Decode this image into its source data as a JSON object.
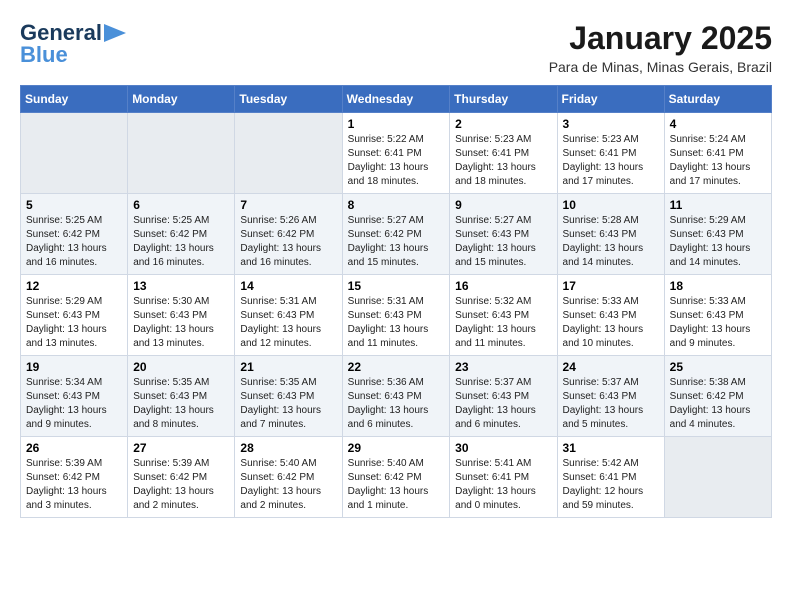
{
  "logo": {
    "line1": "General",
    "line2": "Blue"
  },
  "title": "January 2025",
  "location": "Para de Minas, Minas Gerais, Brazil",
  "days_header": [
    "Sunday",
    "Monday",
    "Tuesday",
    "Wednesday",
    "Thursday",
    "Friday",
    "Saturday"
  ],
  "weeks": [
    [
      {
        "day": "",
        "info": ""
      },
      {
        "day": "",
        "info": ""
      },
      {
        "day": "",
        "info": ""
      },
      {
        "day": "1",
        "info": "Sunrise: 5:22 AM\nSunset: 6:41 PM\nDaylight: 13 hours\nand 18 minutes."
      },
      {
        "day": "2",
        "info": "Sunrise: 5:23 AM\nSunset: 6:41 PM\nDaylight: 13 hours\nand 18 minutes."
      },
      {
        "day": "3",
        "info": "Sunrise: 5:23 AM\nSunset: 6:41 PM\nDaylight: 13 hours\nand 17 minutes."
      },
      {
        "day": "4",
        "info": "Sunrise: 5:24 AM\nSunset: 6:41 PM\nDaylight: 13 hours\nand 17 minutes."
      }
    ],
    [
      {
        "day": "5",
        "info": "Sunrise: 5:25 AM\nSunset: 6:42 PM\nDaylight: 13 hours\nand 16 minutes."
      },
      {
        "day": "6",
        "info": "Sunrise: 5:25 AM\nSunset: 6:42 PM\nDaylight: 13 hours\nand 16 minutes."
      },
      {
        "day": "7",
        "info": "Sunrise: 5:26 AM\nSunset: 6:42 PM\nDaylight: 13 hours\nand 16 minutes."
      },
      {
        "day": "8",
        "info": "Sunrise: 5:27 AM\nSunset: 6:42 PM\nDaylight: 13 hours\nand 15 minutes."
      },
      {
        "day": "9",
        "info": "Sunrise: 5:27 AM\nSunset: 6:43 PM\nDaylight: 13 hours\nand 15 minutes."
      },
      {
        "day": "10",
        "info": "Sunrise: 5:28 AM\nSunset: 6:43 PM\nDaylight: 13 hours\nand 14 minutes."
      },
      {
        "day": "11",
        "info": "Sunrise: 5:29 AM\nSunset: 6:43 PM\nDaylight: 13 hours\nand 14 minutes."
      }
    ],
    [
      {
        "day": "12",
        "info": "Sunrise: 5:29 AM\nSunset: 6:43 PM\nDaylight: 13 hours\nand 13 minutes."
      },
      {
        "day": "13",
        "info": "Sunrise: 5:30 AM\nSunset: 6:43 PM\nDaylight: 13 hours\nand 13 minutes."
      },
      {
        "day": "14",
        "info": "Sunrise: 5:31 AM\nSunset: 6:43 PM\nDaylight: 13 hours\nand 12 minutes."
      },
      {
        "day": "15",
        "info": "Sunrise: 5:31 AM\nSunset: 6:43 PM\nDaylight: 13 hours\nand 11 minutes."
      },
      {
        "day": "16",
        "info": "Sunrise: 5:32 AM\nSunset: 6:43 PM\nDaylight: 13 hours\nand 11 minutes."
      },
      {
        "day": "17",
        "info": "Sunrise: 5:33 AM\nSunset: 6:43 PM\nDaylight: 13 hours\nand 10 minutes."
      },
      {
        "day": "18",
        "info": "Sunrise: 5:33 AM\nSunset: 6:43 PM\nDaylight: 13 hours\nand 9 minutes."
      }
    ],
    [
      {
        "day": "19",
        "info": "Sunrise: 5:34 AM\nSunset: 6:43 PM\nDaylight: 13 hours\nand 9 minutes."
      },
      {
        "day": "20",
        "info": "Sunrise: 5:35 AM\nSunset: 6:43 PM\nDaylight: 13 hours\nand 8 minutes."
      },
      {
        "day": "21",
        "info": "Sunrise: 5:35 AM\nSunset: 6:43 PM\nDaylight: 13 hours\nand 7 minutes."
      },
      {
        "day": "22",
        "info": "Sunrise: 5:36 AM\nSunset: 6:43 PM\nDaylight: 13 hours\nand 6 minutes."
      },
      {
        "day": "23",
        "info": "Sunrise: 5:37 AM\nSunset: 6:43 PM\nDaylight: 13 hours\nand 6 minutes."
      },
      {
        "day": "24",
        "info": "Sunrise: 5:37 AM\nSunset: 6:43 PM\nDaylight: 13 hours\nand 5 minutes."
      },
      {
        "day": "25",
        "info": "Sunrise: 5:38 AM\nSunset: 6:42 PM\nDaylight: 13 hours\nand 4 minutes."
      }
    ],
    [
      {
        "day": "26",
        "info": "Sunrise: 5:39 AM\nSunset: 6:42 PM\nDaylight: 13 hours\nand 3 minutes."
      },
      {
        "day": "27",
        "info": "Sunrise: 5:39 AM\nSunset: 6:42 PM\nDaylight: 13 hours\nand 2 minutes."
      },
      {
        "day": "28",
        "info": "Sunrise: 5:40 AM\nSunset: 6:42 PM\nDaylight: 13 hours\nand 2 minutes."
      },
      {
        "day": "29",
        "info": "Sunrise: 5:40 AM\nSunset: 6:42 PM\nDaylight: 13 hours\nand 1 minute."
      },
      {
        "day": "30",
        "info": "Sunrise: 5:41 AM\nSunset: 6:41 PM\nDaylight: 13 hours\nand 0 minutes."
      },
      {
        "day": "31",
        "info": "Sunrise: 5:42 AM\nSunset: 6:41 PM\nDaylight: 12 hours\nand 59 minutes."
      },
      {
        "day": "",
        "info": ""
      }
    ]
  ]
}
